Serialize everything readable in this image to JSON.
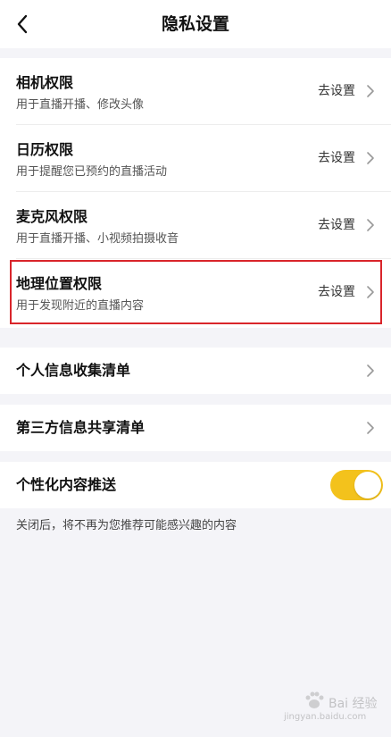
{
  "header": {
    "title": "隐私设置",
    "back_icon": "chevron-left-icon"
  },
  "permissions": [
    {
      "title": "相机权限",
      "desc": "用于直播开播、修改头像",
      "action": "去设置"
    },
    {
      "title": "日历权限",
      "desc": "用于提醒您已预约的直播活动",
      "action": "去设置"
    },
    {
      "title": "麦克风权限",
      "desc": "用于直播开播、小视频拍摄收音",
      "action": "去设置"
    },
    {
      "title": "地理位置权限",
      "desc": "用于发现附近的直播内容",
      "action": "去设置"
    }
  ],
  "lists": {
    "personal_info": "个人信息收集清单",
    "third_party": "第三方信息共享清单"
  },
  "personalization": {
    "label": "个性化内容推送",
    "enabled": true,
    "note": "关闭后，将不再为您推荐可能感兴趣的内容"
  },
  "colors": {
    "toggle_on": "#f3c21c",
    "highlight": "#d9252b",
    "background": "#f4f4f8"
  },
  "watermark": {
    "brand": "Bai 经验",
    "url": "jingyan.baidu.com"
  }
}
